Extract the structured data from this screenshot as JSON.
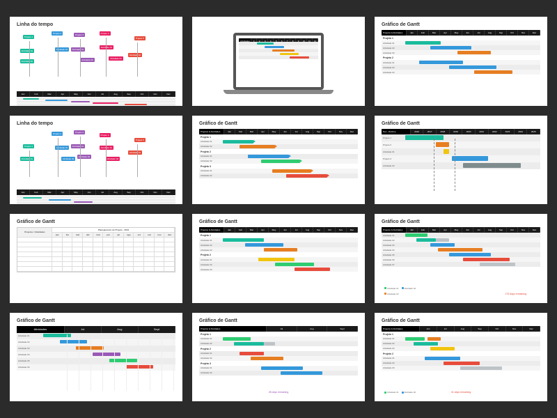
{
  "titles": {
    "timeline": "Linha do tempo",
    "gantt": "Gráfico de Gantt"
  },
  "header_labels": {
    "projects_activities": "Projetos & Atividades",
    "projects_slash": "Projetos / Atividades",
    "activities": "Atividades",
    "project1": "Projeto 1",
    "project2": "Projeto 2",
    "project3": "Projeto 3",
    "planning": "Planejamento de Projeto - 2016"
  },
  "months": {
    "short_en": [
      "Jan",
      "Feb",
      "Mar",
      "Apr",
      "May",
      "Jun",
      "Jul",
      "Aug",
      "Sep",
      "Oct",
      "Nov",
      "Dec"
    ],
    "short_pt": [
      "jan",
      "fev",
      "mar",
      "abr",
      "mai",
      "jun",
      "jul",
      "ago",
      "set",
      "out",
      "nov",
      "dez"
    ],
    "jas": [
      "Jul",
      "Aug",
      "Sept"
    ],
    "jjason": [
      "Jun",
      "Jul",
      "Aug",
      "Sep",
      "Oct",
      "Nov",
      "Dec"
    ]
  },
  "years": [
    "2016",
    "2017",
    "2018",
    "2019",
    "2020",
    "2021",
    "2022",
    "2023",
    "2024",
    "2025"
  ],
  "tasks": {
    "activity_prefix": "Atividade 0",
    "a01": "Atividade 01",
    "a02": "Atividade 02",
    "a03": "Atividade 03",
    "a04": "Atividade 04",
    "a05": "Atividade 05",
    "a06": "Atividade 06",
    "a07": "Atividade 07"
  },
  "timeline_boxes": {
    "p1": "Projeto 1",
    "p2": "Projeto 2",
    "p3": "Projeto 3",
    "p4": "Projeto 4",
    "p5": "Projeto 5"
  },
  "notes": {
    "days28": "28 days remaining",
    "days41": "41 days remaining",
    "days175": "175 days remaining"
  },
  "slide6_years_header": "Nov - Div/Ano"
}
